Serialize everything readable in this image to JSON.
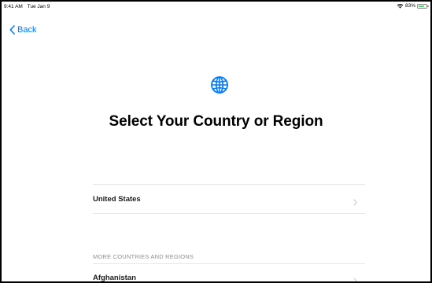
{
  "status_bar": {
    "time": "9:41 AM",
    "date": "Tue Jan 9",
    "battery_percent_text": "83%",
    "battery_level": 0.83,
    "wifi_icon": "wifi-icon",
    "battery_icon": "battery-icon"
  },
  "nav": {
    "back_label": "Back",
    "back_icon": "chevron-left-icon"
  },
  "header": {
    "icon": "globe-icon",
    "title": "Select Your Country or Region"
  },
  "suggested": {
    "items": [
      {
        "label": "United States"
      }
    ]
  },
  "more": {
    "section_title": "MORE COUNTRIES AND REGIONS",
    "items": [
      {
        "label": "Afghanistan"
      }
    ]
  },
  "colors": {
    "accent": "#007aff",
    "battery": "#4cd964",
    "separator": "#e5e5ea",
    "secondary_text": "#8e8e93"
  }
}
